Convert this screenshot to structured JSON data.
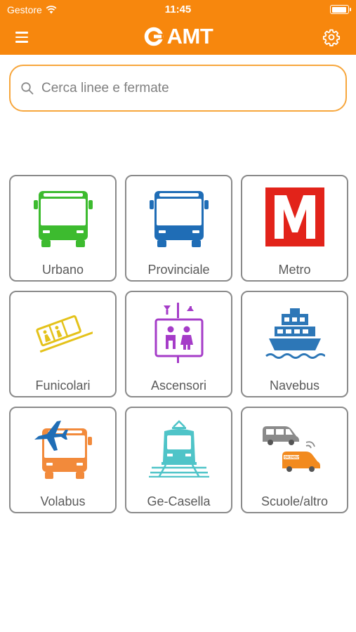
{
  "status_bar": {
    "carrier": "Gestore",
    "time": "11:45"
  },
  "nav": {
    "logo_text": "AMT",
    "menu_icon": "hamburger-menu-icon",
    "settings_icon": "gear-icon"
  },
  "search": {
    "placeholder": "Cerca linee e fermate",
    "value": ""
  },
  "colors": {
    "header": "#F7870D",
    "search_border": "#F7A63C"
  },
  "categories": [
    {
      "label": "Urbano",
      "icon": "bus-icon",
      "color": "#3DBB2F"
    },
    {
      "label": "Provinciale",
      "icon": "bus-icon",
      "color": "#1F6DB6"
    },
    {
      "label": "Metro",
      "icon": "metro-icon",
      "color": "#E2231A"
    },
    {
      "label": "Funicolari",
      "icon": "funicular-icon",
      "color": "#E4C21A"
    },
    {
      "label": "Ascensori",
      "icon": "elevator-icon",
      "color": "#A53CC8"
    },
    {
      "label": "Navebus",
      "icon": "ferry-icon",
      "color": "#2D77B7"
    },
    {
      "label": "Volabus",
      "icon": "airport-bus-icon",
      "color": "#F28A3B"
    },
    {
      "label": "Ge-Casella",
      "icon": "train-icon",
      "color": "#4FC4C8"
    },
    {
      "label": "Scuole/altro",
      "icon": "van-icon",
      "color": "#F28A1E",
      "badge_text": "DRINBUS"
    }
  ]
}
